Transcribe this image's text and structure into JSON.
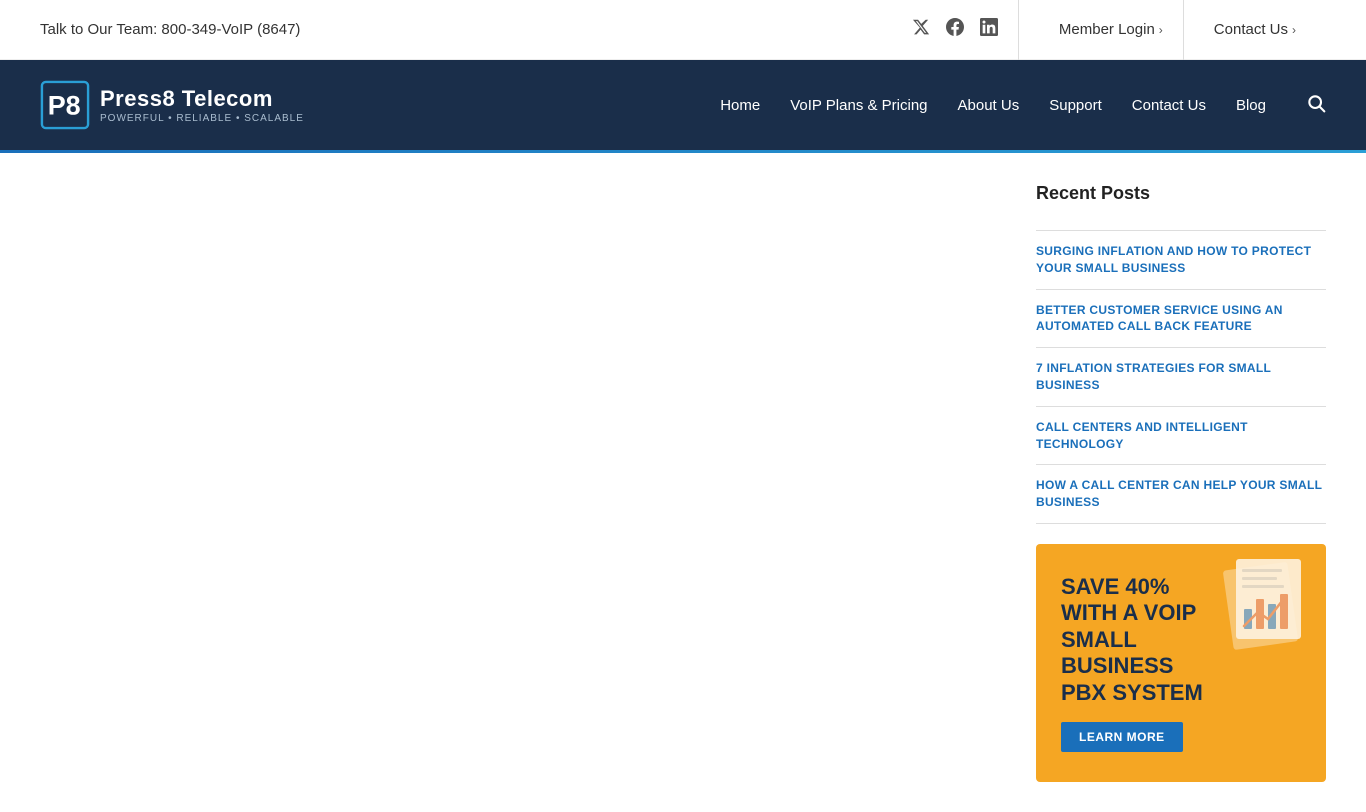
{
  "topbar": {
    "phone_text": "Talk to Our Team: 800-349-VoIP (8647)",
    "member_login_label": "Member Login",
    "contact_us_label": "Contact Us"
  },
  "social": {
    "twitter_icon": "twitter-icon",
    "facebook_icon": "facebook-icon",
    "linkedin_icon": "linkedin-icon"
  },
  "nav": {
    "logo_brand": "Press8 Telecom",
    "logo_tagline": "POWERFUL • RELIABLE • SCALABLE",
    "links": [
      {
        "label": "Home",
        "id": "nav-home"
      },
      {
        "label": "VoIP Plans & Pricing",
        "id": "nav-voip"
      },
      {
        "label": "About Us",
        "id": "nav-about"
      },
      {
        "label": "Support",
        "id": "nav-support"
      },
      {
        "label": "Contact Us",
        "id": "nav-contact"
      },
      {
        "label": "Blog",
        "id": "nav-blog"
      }
    ]
  },
  "sidebar": {
    "recent_posts_title": "Recent Posts",
    "posts": [
      {
        "title": "SURGING INFLATION AND HOW TO PROTECT YOUR SMALL BUSINESS"
      },
      {
        "title": "BETTER CUSTOMER SERVICE USING AN AUTOMATED CALL BACK FEATURE"
      },
      {
        "title": "7 INFLATION STRATEGIES FOR SMALL BUSINESS"
      },
      {
        "title": "CALL CENTERS AND INTELLIGENT TECHNOLOGY"
      },
      {
        "title": "HOW A CALL CENTER CAN HELP YOUR SMALL BUSINESS"
      }
    ],
    "ad": {
      "text": "SAVE 40% WITH A VOIP SMALL BUSINESS PBX SYSTEM",
      "button_label": "LEARN MORE"
    }
  }
}
